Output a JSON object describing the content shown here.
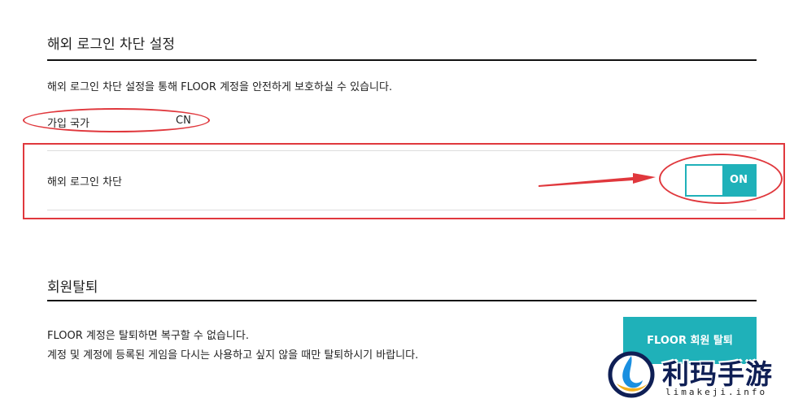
{
  "overseas_block": {
    "title": "해외 로그인 차단 설정",
    "description": "해외 로그인 차단 설정을 통해 FLOOR 계정을 안전하게 보호하실 수 있습니다.",
    "country_label": "가입 국가",
    "country_value": "CN",
    "toggle_row_label": "해외 로그인 차단",
    "toggle_state_label": "ON",
    "toggle_state": true
  },
  "withdraw": {
    "title": "회원탈퇴",
    "line1": "FLOOR 계정은 탈퇴하면 복구할 수 없습니다.",
    "line2": "계정 및 계정에 등록된 게임을 다시는 사용하고 싶지 않을 때만 탈퇴하시기 바랍니다.",
    "button_label": "FLOOR 회원 탈퇴"
  },
  "watermark": {
    "name": "利玛手游",
    "url": "limakeji.info"
  },
  "colors": {
    "accent": "#1fb1b9",
    "annotation": "#e0383d",
    "rule": "#111111"
  },
  "icons": {
    "watermark_logo": "swirl-logo-icon",
    "annotation_arrow": "arrow-right-icon"
  }
}
